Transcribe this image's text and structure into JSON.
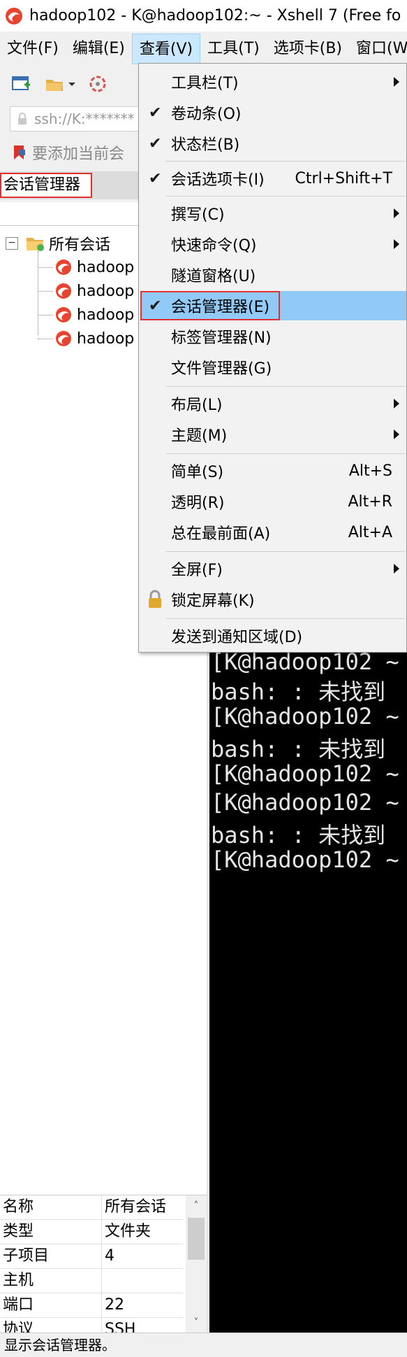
{
  "window": {
    "title": "hadoop102 - K@hadoop102:~ - Xshell 7 (Free fo"
  },
  "menubar": {
    "items": [
      "文件(F)",
      "编辑(E)",
      "查看(V)",
      "工具(T)",
      "选项卡(B)",
      "窗口(W"
    ]
  },
  "addressbar": {
    "text": "ssh://K:*******"
  },
  "linksbar": {
    "text": "要添加当前会"
  },
  "session_manager": {
    "header": "会话管理器",
    "root_label": "所有会话",
    "root_expander": "−",
    "sessions": [
      "hadoop",
      "hadoop",
      "hadoop",
      "hadoop"
    ]
  },
  "view_menu": {
    "items": [
      {
        "label": "工具栏(T)",
        "checked": false,
        "submenu": true,
        "shortcut": ""
      },
      {
        "label": "卷动条(O)",
        "checked": true,
        "submenu": false,
        "shortcut": ""
      },
      {
        "label": "状态栏(B)",
        "checked": true,
        "submenu": false,
        "shortcut": ""
      },
      {
        "label": "会话选项卡(I)",
        "checked": true,
        "submenu": false,
        "shortcut": "Ctrl+Shift+T"
      },
      {
        "label": "撰写(C)",
        "checked": false,
        "submenu": true,
        "shortcut": ""
      },
      {
        "label": "快速命令(Q)",
        "checked": false,
        "submenu": true,
        "shortcut": ""
      },
      {
        "label": "隧道窗格(U)",
        "checked": false,
        "submenu": false,
        "shortcut": ""
      },
      {
        "label": "会话管理器(E)",
        "checked": true,
        "submenu": false,
        "shortcut": ""
      },
      {
        "label": "标签管理器(N)",
        "checked": false,
        "submenu": false,
        "shortcut": ""
      },
      {
        "label": "文件管理器(G)",
        "checked": false,
        "submenu": false,
        "shortcut": ""
      },
      {
        "label": "布局(L)",
        "checked": false,
        "submenu": true,
        "shortcut": ""
      },
      {
        "label": "主题(M)",
        "checked": false,
        "submenu": true,
        "shortcut": ""
      },
      {
        "label": "简单(S)",
        "checked": false,
        "submenu": false,
        "shortcut": "Alt+S"
      },
      {
        "label": "透明(R)",
        "checked": false,
        "submenu": false,
        "shortcut": "Alt+R"
      },
      {
        "label": "总在最前面(A)",
        "checked": false,
        "submenu": false,
        "shortcut": "Alt+A"
      },
      {
        "label": "全屏(F)",
        "checked": false,
        "submenu": true,
        "shortcut": ""
      },
      {
        "label": "锁定屏幕(K)",
        "checked": false,
        "submenu": false,
        "shortcut": ""
      },
      {
        "label": "发送到通知区域(D)",
        "checked": false,
        "submenu": false,
        "shortcut": ""
      }
    ],
    "check_mark": "✔"
  },
  "terminal": {
    "lines": [
      "[K@hadoop102 ~",
      "bash: : 未找到",
      "[K@hadoop102 ~",
      "bash: : 未找到",
      "[K@hadoop102 ~",
      "[K@hadoop102 ~",
      "bash: : 未找到",
      "[K@hadoop102 ~"
    ]
  },
  "properties": {
    "rows": [
      {
        "key": "名称",
        "value": "所有会话"
      },
      {
        "key": "类型",
        "value": "文件夹"
      },
      {
        "key": "子项目",
        "value": "4"
      },
      {
        "key": "主机",
        "value": ""
      },
      {
        "key": "端口",
        "value": "22"
      },
      {
        "key": "协议",
        "value": "SSH"
      }
    ],
    "scroll_up": "˄",
    "scroll_down": "˅"
  },
  "statusbar": {
    "text": "显示会话管理器。"
  },
  "colors": {
    "menu_highlight": "#91c9f7",
    "callout_border": "#e03030",
    "terminal_bg": "#000000",
    "terminal_fg": "#e6e6e6"
  }
}
